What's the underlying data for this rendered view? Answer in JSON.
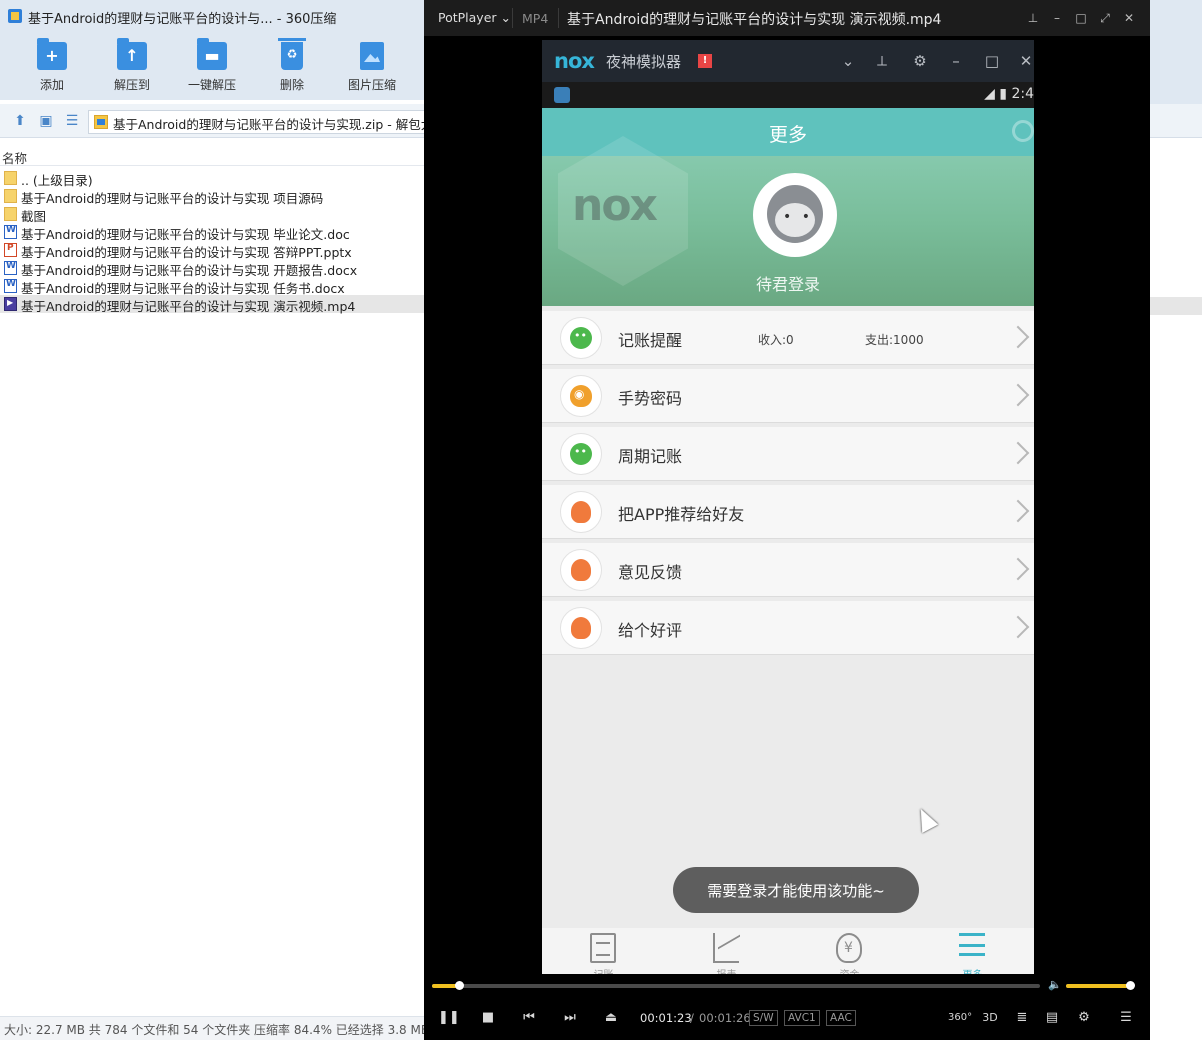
{
  "zip": {
    "title": "基于Android的理财与记账平台的设计与... - 360压缩",
    "toolbar": [
      {
        "label": "添加",
        "icon": "add-icon"
      },
      {
        "label": "解压到",
        "icon": "extract-to-icon"
      },
      {
        "label": "一键解压",
        "icon": "one-click-extract-icon"
      },
      {
        "label": "删除",
        "icon": "delete-icon"
      },
      {
        "label": "图片压缩",
        "icon": "image-compress-icon"
      }
    ],
    "address": "基于Android的理财与记账平台的设计与实现.zip - 解包大小",
    "column_name": "名称",
    "files": [
      {
        "name": ".. (上级目录)",
        "type": "folder"
      },
      {
        "name": "基于Android的理财与记账平台的设计与实现 项目源码",
        "type": "folder"
      },
      {
        "name": "截图",
        "type": "folder"
      },
      {
        "name": "基于Android的理财与记账平台的设计与实现 毕业论文.doc",
        "type": "doc"
      },
      {
        "name": "基于Android的理财与记账平台的设计与实现 答辩PPT.pptx",
        "type": "ppt"
      },
      {
        "name": "基于Android的理财与记账平台的设计与实现 开题报告.docx",
        "type": "doc"
      },
      {
        "name": "基于Android的理财与记账平台的设计与实现 任务书.docx",
        "type": "doc"
      },
      {
        "name": "基于Android的理财与记账平台的设计与实现 演示视频.mp4",
        "type": "mp4",
        "selected": true
      }
    ],
    "status": "大小: 22.7 MB 共 784 个文件和 54 个文件夹 压缩率 84.4% 已经选择 3.8 MB"
  },
  "player": {
    "brand": "PotPlayer",
    "format": "MP4",
    "title": "基于Android的理财与记账平台的设计与实现 演示视频.mp4",
    "time_current": "00:01:23",
    "time_sep": "/",
    "time_total": "00:01:26",
    "tags": [
      "S/W",
      "AVC1",
      "AAC"
    ],
    "extra_buttons": [
      "360°",
      "3D"
    ],
    "progress_fraction": 0.045,
    "volume_fraction": 0.97,
    "accent_color": "#f0c020"
  },
  "emulator": {
    "logo": "nox",
    "name": "夜神模拟器",
    "warning": "!",
    "status_time": "2:4"
  },
  "app": {
    "header_title": "更多",
    "login_text": "待君登录",
    "menu": [
      {
        "label": "记账提醒",
        "icon": "wechat-icon",
        "income": "收入:0",
        "expense": "支出:1000"
      },
      {
        "label": "手势密码",
        "icon": "weibo-icon"
      },
      {
        "label": "周期记账",
        "icon": "wechat-icon"
      },
      {
        "label": "把APP推荐给好友",
        "icon": "qq-icon"
      },
      {
        "label": "意见反馈",
        "icon": "qq-icon"
      },
      {
        "label": "给个好评",
        "icon": "qq-icon"
      }
    ],
    "toast": "需要登录才能使用该功能~",
    "nav": [
      {
        "label": "记账",
        "icon": "notebook-icon"
      },
      {
        "label": "报表",
        "icon": "chart-icon"
      },
      {
        "label": "资金",
        "icon": "money-bag-icon"
      },
      {
        "label": "更多",
        "icon": "menu-list-icon",
        "active": true
      }
    ],
    "header_color": "#5fc2bd",
    "accent_color": "#3bb3c8"
  }
}
